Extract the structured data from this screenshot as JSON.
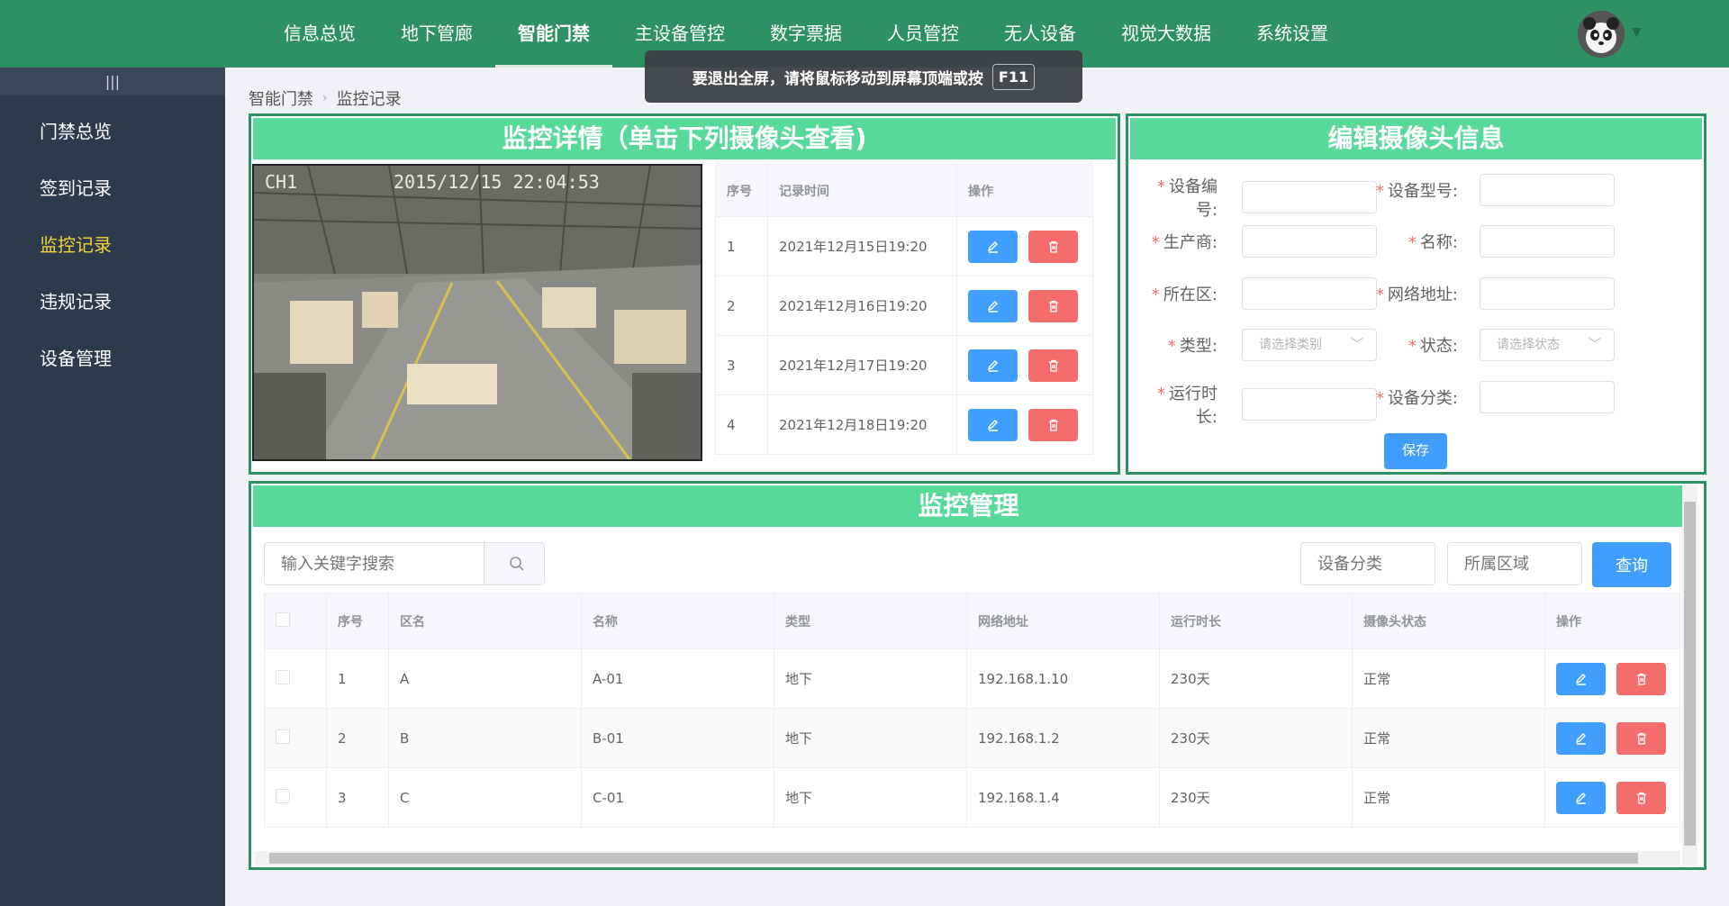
{
  "nav": {
    "items": [
      "信息总览",
      "地下管廊",
      "智能门禁",
      "主设备管控",
      "数字票据",
      "人员管控",
      "无人设备",
      "视觉大数据",
      "系统设置"
    ],
    "active": "智能门禁"
  },
  "toast": {
    "text": "要退出全屏，请将鼠标移动到屏幕顶端或按",
    "key": "F11"
  },
  "sidebar": {
    "toggle": "|||",
    "items": [
      "门禁总览",
      "签到记录",
      "监控记录",
      "违规记录",
      "设备管理"
    ],
    "active": "监控记录"
  },
  "breadcrumb": {
    "parent": "智能门禁",
    "current": "监控记录"
  },
  "detail": {
    "title": "监控详情（单击下列摄像头查看)",
    "camera": {
      "channel": "CH1",
      "timestamp": "2015/12/15  22:04:53"
    },
    "table": {
      "headers": [
        "序号",
        "记录时间",
        "操作"
      ],
      "rows": [
        {
          "no": "1",
          "time": "2021年12月15日19:20"
        },
        {
          "no": "2",
          "time": "2021年12月16日19:20"
        },
        {
          "no": "3",
          "time": "2021年12月17日19:20"
        },
        {
          "no": "4",
          "time": "2021年12月18日19:20"
        }
      ]
    }
  },
  "edit": {
    "title": "编辑摄像头信息",
    "labels": {
      "device_no": "设备编号:",
      "model": "设备型号:",
      "maker": "生产商:",
      "name": "名称:",
      "area": "所在区:",
      "ip": "网络地址:",
      "type": "类型:",
      "status": "状态:",
      "runtime": "运行时长:",
      "category": "设备分类:"
    },
    "type_placeholder": "请选择类别",
    "status_placeholder": "请选择状态",
    "save": "保存"
  },
  "manage": {
    "title": "监控管理",
    "search_placeholder": "输入关键字搜索",
    "category_placeholder": "设备分类",
    "region_placeholder": "所属区域",
    "query": "查询",
    "headers": [
      "序号",
      "区名",
      "名称",
      "类型",
      "网络地址",
      "运行时长",
      "摄像头状态",
      "操作"
    ],
    "rows": [
      {
        "no": "1",
        "area": "A",
        "name": "A-01",
        "type": "地下",
        "ip": "192.168.1.10",
        "runtime": "230天",
        "status": "正常"
      },
      {
        "no": "2",
        "area": "B",
        "name": "B-01",
        "type": "地下",
        "ip": "192.168.1.2",
        "runtime": "230天",
        "status": "正常"
      },
      {
        "no": "3",
        "area": "C",
        "name": "C-01",
        "type": "地下",
        "ip": "192.168.1.4",
        "runtime": "230天",
        "status": "正常"
      }
    ]
  },
  "colors": {
    "topbar": "#2e9163",
    "sidebar": "#2d3a4b",
    "sidebar_active": "#f5d33a",
    "panel_title": "#57d99a",
    "primary": "#409eff",
    "danger": "#f56c6c"
  }
}
